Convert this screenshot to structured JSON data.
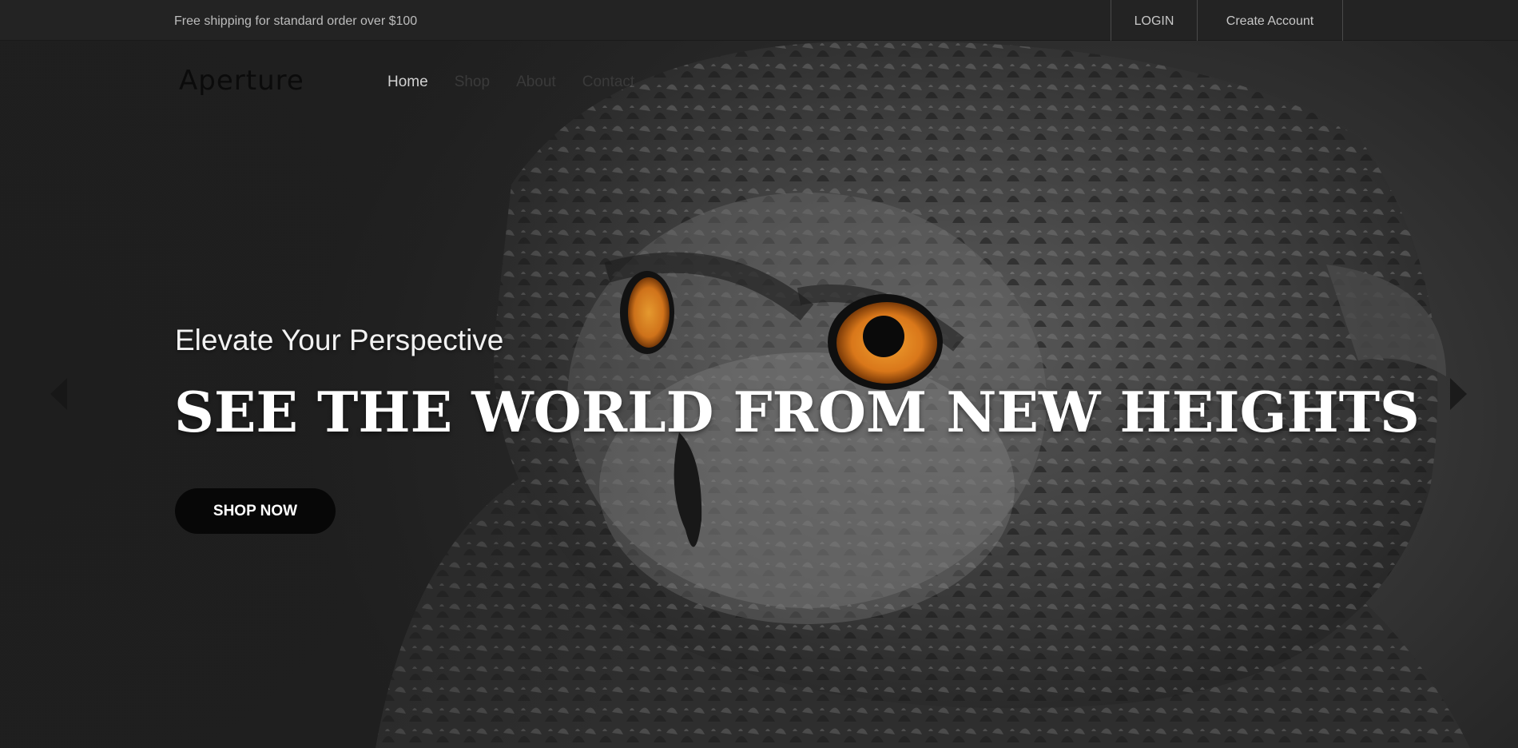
{
  "topbar": {
    "shipping_text": "Free shipping for standard order over $100",
    "login_label": "LOGIN",
    "create_account_label": "Create Account"
  },
  "header": {
    "logo": "Aperture",
    "nav": [
      {
        "label": "Home"
      },
      {
        "label": "Shop"
      },
      {
        "label": "About"
      },
      {
        "label": "Contact"
      }
    ]
  },
  "hero": {
    "subtitle": "Elevate Your Perspective",
    "headline": "SEE THE WORLD FROM NEW HEIGHTS",
    "cta_label": "SHOP NOW",
    "prev_icon": "chevron-left-icon",
    "next_icon": "chevron-right-icon",
    "image_subject": "owl-icon",
    "eye_color": "#e08a1e"
  },
  "colors": {
    "topbar_bg": "#232323",
    "hero_bg": "#2a2a2a",
    "button_bg": "#070707",
    "text_light": "#ffffff"
  }
}
